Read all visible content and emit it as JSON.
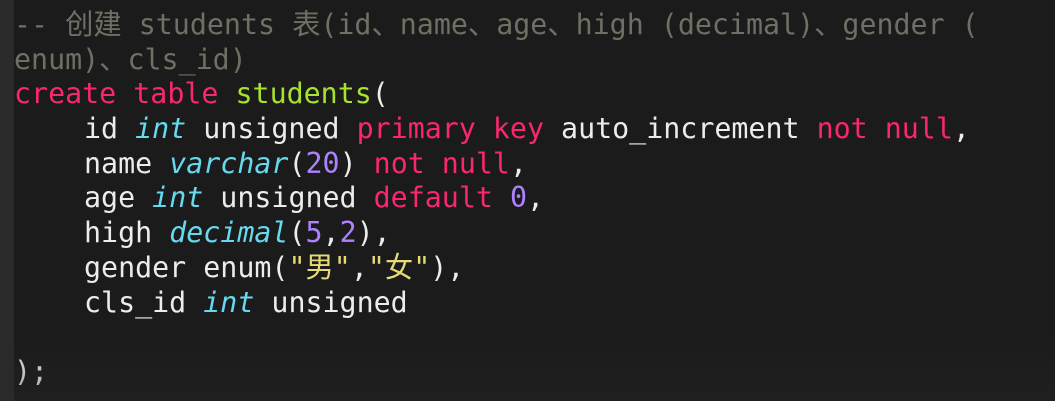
{
  "editor": {
    "theme": {
      "background": "#1b1b1b",
      "comment": "#6f6f63",
      "keyword": "#f92672",
      "identifier": "#a6e22e",
      "type": "#66d9ef",
      "number": "#ae81ff",
      "string": "#e6db74",
      "plain": "#ececec"
    },
    "lines": [
      {
        "tokens": [
          {
            "t": "-- 创建 students 表(id、name、age、high (decimal)、gender (",
            "c": "comment"
          }
        ]
      },
      {
        "tokens": [
          {
            "t": "enum)、cls_id)",
            "c": "comment"
          }
        ]
      },
      {
        "tokens": [
          {
            "t": "create",
            "c": "kw"
          },
          {
            "t": " ",
            "c": "plain"
          },
          {
            "t": "table",
            "c": "kw"
          },
          {
            "t": " ",
            "c": "plain"
          },
          {
            "t": "students",
            "c": "name"
          },
          {
            "t": "(",
            "c": "plain"
          }
        ]
      },
      {
        "indent": true,
        "tokens": [
          {
            "t": "id ",
            "c": "plain"
          },
          {
            "t": "int",
            "c": "type"
          },
          {
            "t": " unsigned ",
            "c": "plain"
          },
          {
            "t": "primary key",
            "c": "kw"
          },
          {
            "t": " auto_increment ",
            "c": "plain"
          },
          {
            "t": "not null",
            "c": "kw"
          },
          {
            "t": ",",
            "c": "plain"
          }
        ]
      },
      {
        "indent": true,
        "tokens": [
          {
            "t": "name ",
            "c": "plain"
          },
          {
            "t": "varchar",
            "c": "type"
          },
          {
            "t": "(",
            "c": "plain"
          },
          {
            "t": "20",
            "c": "num"
          },
          {
            "t": ") ",
            "c": "plain"
          },
          {
            "t": "not null",
            "c": "kw"
          },
          {
            "t": ",",
            "c": "plain"
          }
        ]
      },
      {
        "indent": true,
        "tokens": [
          {
            "t": "age ",
            "c": "plain"
          },
          {
            "t": "int",
            "c": "type"
          },
          {
            "t": " unsigned ",
            "c": "plain"
          },
          {
            "t": "default",
            "c": "kw"
          },
          {
            "t": " ",
            "c": "plain"
          },
          {
            "t": "0",
            "c": "num"
          },
          {
            "t": ",",
            "c": "plain"
          }
        ]
      },
      {
        "indent": true,
        "tokens": [
          {
            "t": "high ",
            "c": "plain"
          },
          {
            "t": "decimal",
            "c": "type"
          },
          {
            "t": "(",
            "c": "plain"
          },
          {
            "t": "5",
            "c": "num"
          },
          {
            "t": ",",
            "c": "plain"
          },
          {
            "t": "2",
            "c": "num"
          },
          {
            "t": "),",
            "c": "plain"
          }
        ]
      },
      {
        "indent": true,
        "tokens": [
          {
            "t": "gender enum(",
            "c": "plain"
          },
          {
            "t": "\"男\"",
            "c": "str"
          },
          {
            "t": ",",
            "c": "plain"
          },
          {
            "t": "\"女\"",
            "c": "str"
          },
          {
            "t": "),",
            "c": "plain"
          }
        ]
      },
      {
        "indent": true,
        "tokens": [
          {
            "t": "cls_id ",
            "c": "plain"
          },
          {
            "t": "int",
            "c": "type"
          },
          {
            "t": " unsigned",
            "c": "plain"
          }
        ]
      },
      {
        "tokens": [
          {
            "t": "",
            "c": "plain"
          }
        ]
      },
      {
        "tokens": [
          {
            "t": ");",
            "c": "plain"
          }
        ]
      }
    ]
  }
}
